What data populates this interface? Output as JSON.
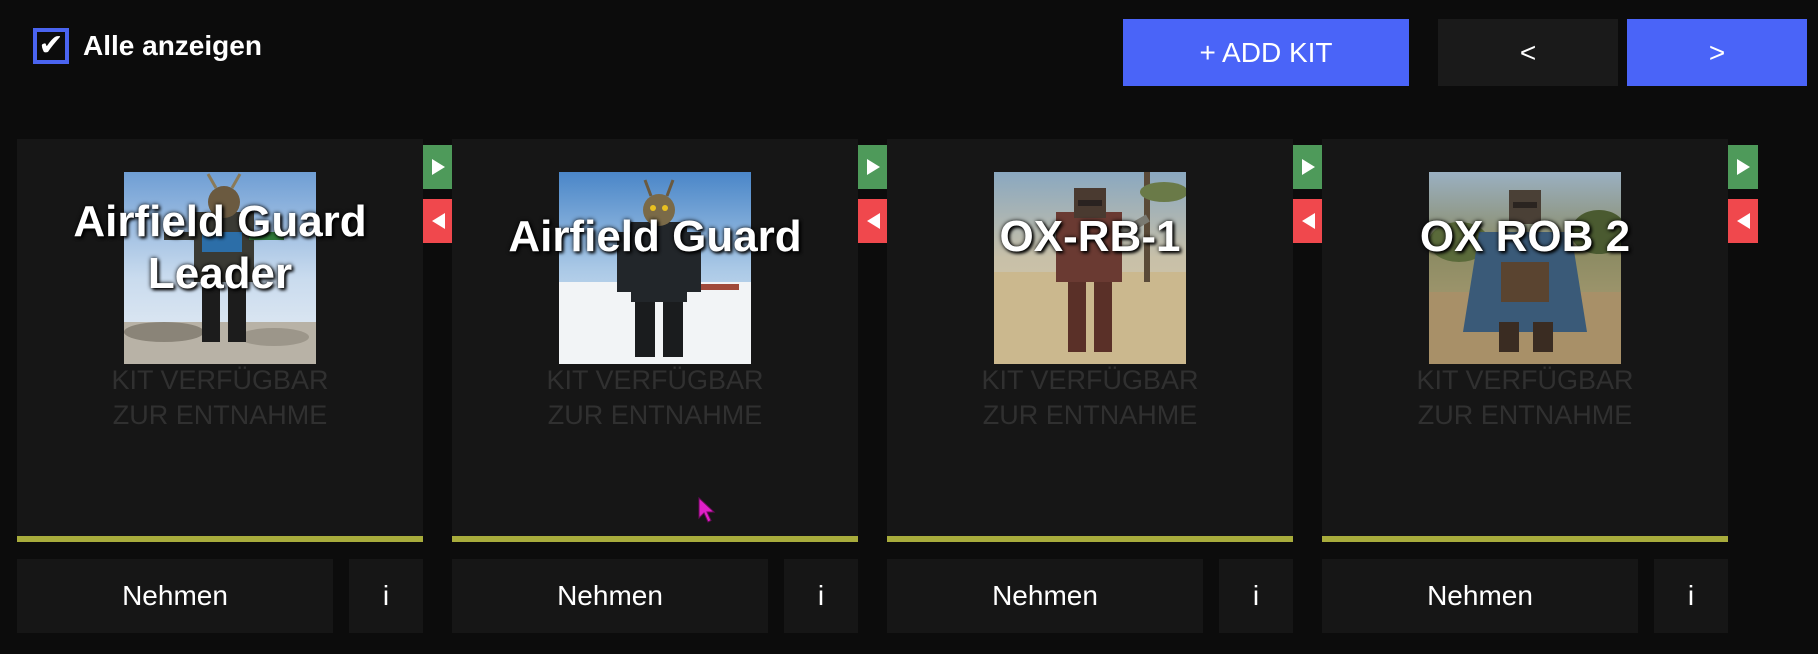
{
  "header": {
    "show_all_label": "Alle anzeigen",
    "show_all_checked": true,
    "checkmark": "✔",
    "add_kit_label": "+ ADD KIT",
    "prev_label": "<",
    "next_label": ">"
  },
  "kits": [
    {
      "title": "Airfield Guard Leader",
      "status_line1": "KIT VERFÜGBAR",
      "status_line2": "ZUR ENTNAHME",
      "take_label": "Nehmen",
      "info_label": "i",
      "image_icon": "airfield-guard-leader-portrait"
    },
    {
      "title": "Airfield Guard",
      "status_line1": "KIT VERFÜGBAR",
      "status_line2": "ZUR ENTNAHME",
      "take_label": "Nehmen",
      "info_label": "i",
      "image_icon": "airfield-guard-portrait"
    },
    {
      "title": "OX-RB-1",
      "status_line1": "KIT VERFÜGBAR",
      "status_line2": "ZUR ENTNAHME",
      "take_label": "Nehmen",
      "info_label": "i",
      "image_icon": "ox-rb-1-portrait"
    },
    {
      "title": "OX ROB 2",
      "status_line1": "KIT VERFÜGBAR",
      "status_line2": "ZUR ENTNAHME",
      "take_label": "Nehmen",
      "info_label": "i",
      "image_icon": "ox-rob-2-portrait"
    }
  ],
  "colors": {
    "background": "#0c0c0c",
    "card": "#161616",
    "accent_blue": "#4a64f8",
    "progress_bar": "#a8ac3c",
    "play_green": "#4e9a5a",
    "back_red": "#f0484d",
    "status_text": "#303030",
    "cursor": "#e020c8"
  }
}
